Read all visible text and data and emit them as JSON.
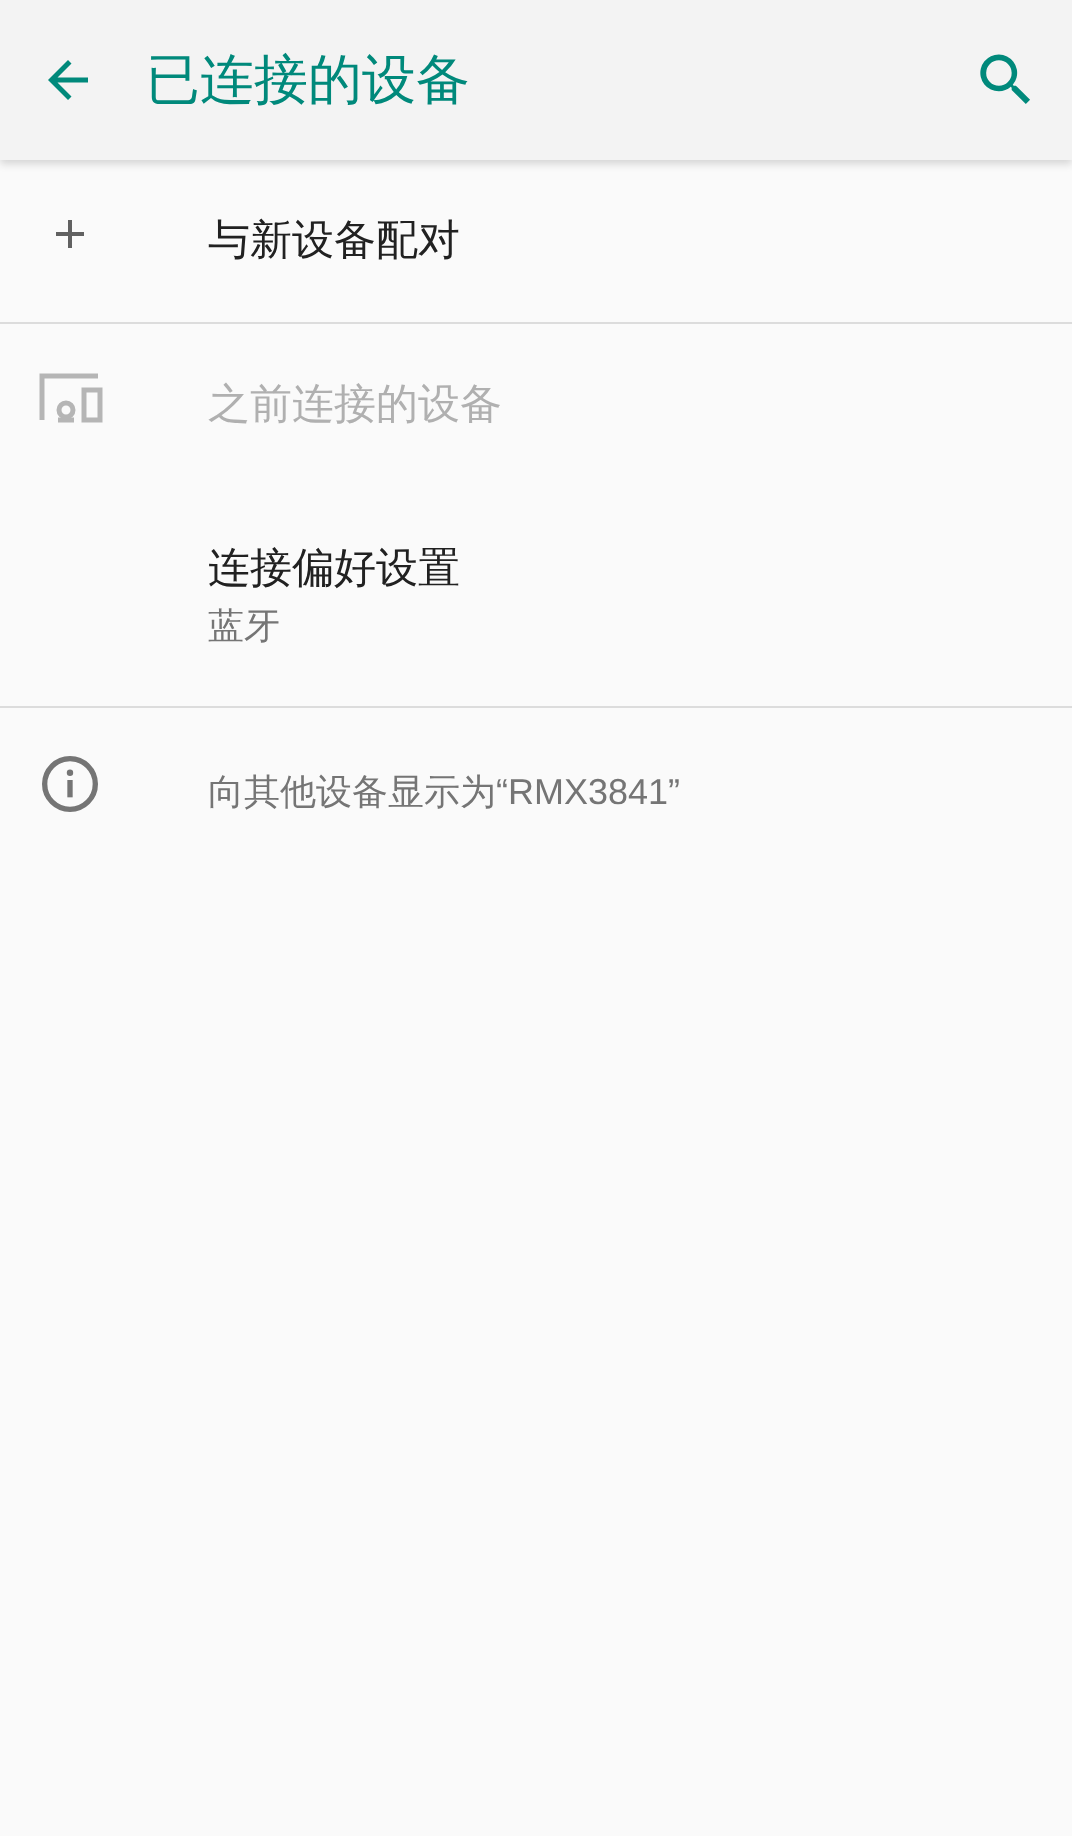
{
  "app_bar": {
    "title": "已连接的设备"
  },
  "sections": [
    [
      {
        "kind": "add",
        "title": "与新设备配对",
        "disabled": false
      }
    ],
    [
      {
        "kind": "previous",
        "title": "之前连接的设备",
        "disabled": true
      },
      {
        "kind": "preference",
        "title": "连接偏好设置",
        "subtitle": "蓝牙",
        "disabled": false
      }
    ]
  ],
  "footer": {
    "text": "向其他设备显示为“RMX3841”"
  }
}
